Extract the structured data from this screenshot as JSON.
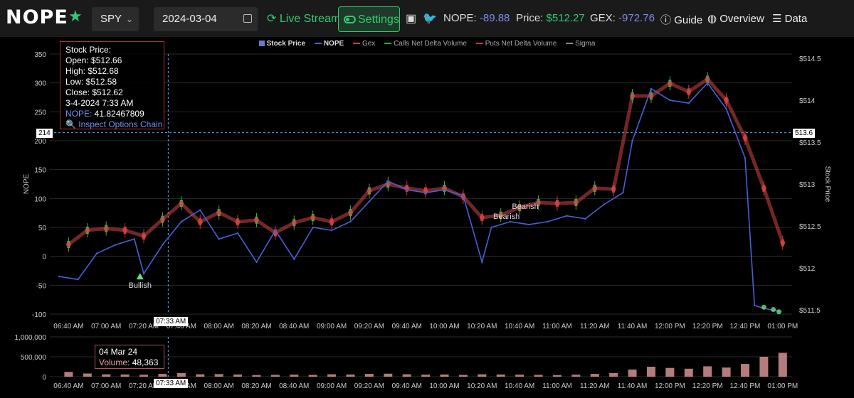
{
  "header": {
    "logo": "NOPE",
    "ticker": "SPY",
    "date": "2024-03-04",
    "live_stream": "Live Stream",
    "settings": "Settings",
    "nope_label": "NOPE:",
    "nope_value": "-89.88",
    "price_label": "Price:",
    "price_value": "$512.27",
    "gex_label": "GEX:",
    "gex_value": "-972.76",
    "guide": "Guide",
    "overview": "Overview",
    "data": "Data"
  },
  "legend": [
    "Stock Price",
    "NOPE",
    "Gex",
    "Calls Net Delta Volume",
    "Puts Net Delta Volume",
    "Sigma"
  ],
  "tooltip": {
    "title": "Stock Price:",
    "open": "Open:   $512.66",
    "high": "High:   $512.68",
    "low": "Low:   $512.58",
    "close": "Close:   $512.62",
    "time": "3-4-2024 7:33 AM",
    "nope_label": "NOPE:",
    "nope_value": " 41.82467809",
    "link": "Inspect Options Chain"
  },
  "volume_tooltip": {
    "date": "04 Mar 24",
    "label": "Volume:",
    "value": "48,363"
  },
  "crosshair": {
    "time_label": "07:33 AM",
    "nope_label": "214",
    "price_label": "513.6"
  },
  "chart_data": [
    {
      "type": "line",
      "title": "",
      "ylabel_left": "NOPE",
      "ylabel_right": "Stock Price",
      "xlabel": "",
      "x_ticks": [
        "06:40 AM",
        "07:00 AM",
        "07:20 AM",
        "07:40 AM",
        "08:00 AM",
        "08:20 AM",
        "08:40 AM",
        "09:00 AM",
        "09:20 AM",
        "09:40 AM",
        "10:00 AM",
        "10:20 AM",
        "10:40 AM",
        "11:00 AM",
        "11:20 AM",
        "11:40 AM",
        "12:00 PM",
        "12:20 PM",
        "12:40 PM",
        "01:00 PM"
      ],
      "ylim_left": [
        -100,
        350
      ],
      "y_ticks_left": [
        -100,
        -50,
        0,
        50,
        100,
        150,
        200,
        250,
        300,
        350
      ],
      "ylim_right": [
        511.45,
        514.55
      ],
      "y_ticks_right": [
        "$511.5",
        "$512",
        "$512.5",
        "$513",
        "$513.5",
        "$514",
        "$514.5"
      ],
      "annotations": [
        "Bullish",
        "Bearish",
        "Bearish"
      ],
      "series": [
        {
          "name": "Stock Price",
          "axis": "right",
          "kind": "candlestick_close",
          "x": [
            "06:40",
            "06:50",
            "07:00",
            "07:10",
            "07:20",
            "07:30",
            "07:40",
            "07:50",
            "08:00",
            "08:10",
            "08:20",
            "08:30",
            "08:40",
            "08:50",
            "09:00",
            "09:10",
            "09:20",
            "09:30",
            "09:40",
            "09:50",
            "10:00",
            "10:10",
            "10:20",
            "10:30",
            "10:40",
            "10:50",
            "11:00",
            "11:10",
            "11:20",
            "11:30",
            "11:40",
            "11:50",
            "12:00",
            "12:10",
            "12:20",
            "12:30",
            "12:40",
            "12:50",
            "13:00"
          ],
          "values": [
            512.28,
            512.45,
            512.47,
            512.45,
            512.38,
            512.58,
            512.77,
            512.55,
            512.66,
            512.55,
            512.57,
            512.42,
            512.54,
            512.6,
            512.55,
            512.66,
            512.92,
            513.0,
            512.95,
            512.92,
            512.95,
            512.85,
            512.6,
            512.63,
            512.72,
            512.78,
            512.77,
            512.78,
            512.95,
            512.94,
            514.05,
            514.05,
            514.2,
            514.1,
            514.25,
            514.0,
            513.55,
            512.95,
            512.3
          ]
        },
        {
          "name": "NOPE",
          "axis": "left",
          "x": [
            "06:35",
            "06:45",
            "06:55",
            "07:05",
            "07:15",
            "07:20",
            "07:30",
            "07:40",
            "07:50",
            "08:00",
            "08:10",
            "08:20",
            "08:30",
            "08:40",
            "08:50",
            "09:00",
            "09:10",
            "09:20",
            "09:30",
            "09:40",
            "09:50",
            "10:00",
            "10:10",
            "10:20",
            "10:25",
            "10:35",
            "10:45",
            "10:55",
            "11:05",
            "11:15",
            "11:25",
            "11:35",
            "11:40",
            "11:50",
            "12:00",
            "12:10",
            "12:20",
            "12:30",
            "12:40",
            "12:45",
            "12:50",
            "12:58"
          ],
          "values": [
            -35,
            -40,
            5,
            20,
            30,
            -30,
            20,
            60,
            80,
            30,
            40,
            -10,
            45,
            -5,
            50,
            45,
            60,
            95,
            130,
            115,
            110,
            115,
            105,
            -10,
            50,
            60,
            55,
            60,
            70,
            65,
            90,
            110,
            200,
            290,
            270,
            265,
            300,
            255,
            170,
            -85,
            -90,
            -95
          ]
        }
      ]
    },
    {
      "type": "bar",
      "title": "",
      "ylabel": "",
      "ylim": [
        0,
        1000000
      ],
      "y_ticks": [
        "0",
        "500,000",
        "1,000,000"
      ],
      "x_ticks": [
        "06:40 AM",
        "07:00 AM",
        "07:20 AM",
        "07:40 AM",
        "08:00 AM",
        "08:20 AM",
        "08:40 AM",
        "09:00 AM",
        "09:20 AM",
        "09:40 AM",
        "10:00 AM",
        "10:20 AM",
        "10:40 AM",
        "11:00 AM",
        "11:20 AM",
        "11:40 AM",
        "12:00 PM",
        "12:20 PM",
        "12:40 PM",
        "01:00 PM"
      ],
      "series": [
        {
          "name": "Volume",
          "x": [
            "06:40",
            "06:50",
            "07:00",
            "07:10",
            "07:20",
            "07:30",
            "07:40",
            "07:50",
            "08:00",
            "08:10",
            "08:20",
            "08:30",
            "08:40",
            "08:50",
            "09:00",
            "09:10",
            "09:20",
            "09:30",
            "09:40",
            "09:50",
            "10:00",
            "10:10",
            "10:20",
            "10:30",
            "10:40",
            "10:50",
            "11:00",
            "11:10",
            "11:20",
            "11:30",
            "11:40",
            "11:50",
            "12:00",
            "12:10",
            "12:20",
            "12:30",
            "12:40",
            "12:50",
            "13:00"
          ],
          "values": [
            120000,
            80000,
            60000,
            55000,
            48363,
            70000,
            90000,
            60000,
            65000,
            55000,
            40000,
            45000,
            50000,
            45000,
            60000,
            55000,
            70000,
            75000,
            60000,
            50000,
            55000,
            45000,
            60000,
            55000,
            50000,
            45000,
            40000,
            50000,
            70000,
            90000,
            180000,
            250000,
            220000,
            200000,
            260000,
            230000,
            320000,
            500000,
            600000
          ]
        }
      ]
    }
  ],
  "colors": {
    "nope": "#4a5fd6",
    "candle_up": "#3fae4a",
    "candle_down": "#c43a3a",
    "gex_dot": "#d24545",
    "marker_bull": "#5fe08a",
    "volume_bar": "#f2a6a6",
    "crosshair": "#5aa0ff",
    "accent": "#2ecc71"
  }
}
